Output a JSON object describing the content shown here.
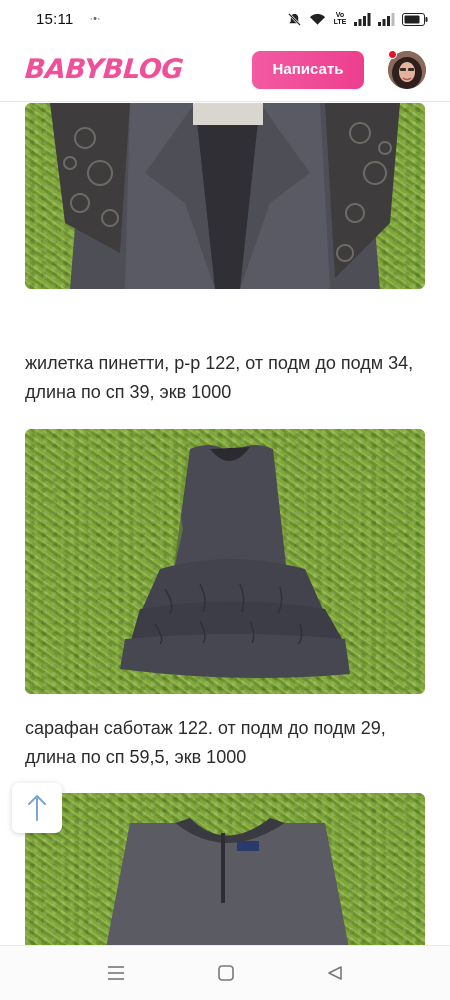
{
  "status_bar": {
    "time": "15:11",
    "notification": "·•·",
    "volte": "Vo LTE"
  },
  "header": {
    "logo": "BABYBLOG",
    "write_button": "Написать"
  },
  "posts": [
    {
      "caption": "жилетка пинетти, р-р 122, от подм до подм 34, длина по сп 39, экв 1000"
    },
    {
      "caption": "сарафан саботаж 122. от подм до подм 29, длина по сп 59,5, экв 1000"
    }
  ],
  "colors": {
    "brand_pink": "#f0509a",
    "grass_green": "#7fa63a",
    "garment_gray": "#55555f"
  },
  "icons": {
    "scroll_up": "arrow-up-icon",
    "nav_menu": "menu-icon",
    "nav_home": "square-icon",
    "nav_back": "triangle-back-icon"
  }
}
